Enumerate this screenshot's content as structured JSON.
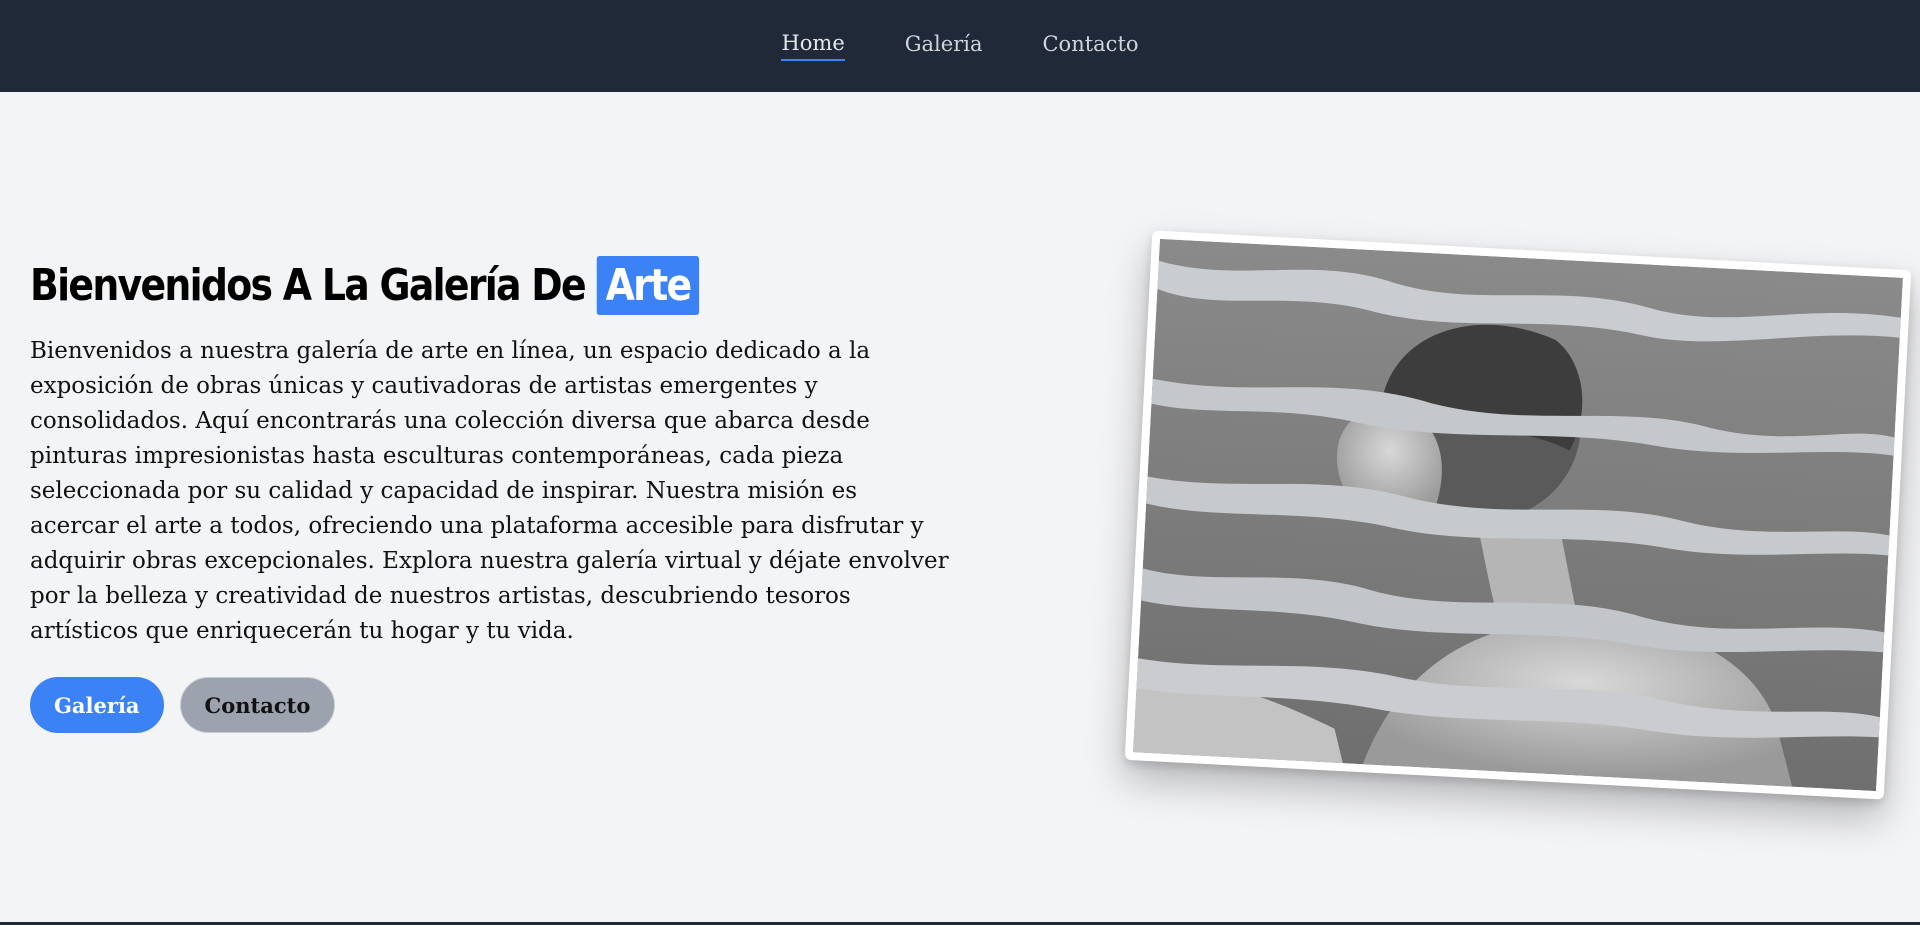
{
  "nav": {
    "items": [
      {
        "label": "Home",
        "active": true
      },
      {
        "label": "Galería",
        "active": false
      },
      {
        "label": "Contacto",
        "active": false
      }
    ]
  },
  "hero": {
    "title_main": "Bienvenidos A La Galería De",
    "title_highlight": "Arte",
    "description": "Bienvenidos a nuestra galería de arte en línea, un espacio dedicado a la exposición de obras únicas y cautivadoras de artistas emergentes y consolidados. Aquí encontrarás una colección diversa que abarca desde pinturas impresionistas hasta esculturas contemporáneas, cada pieza seleccionada por su calidad y capacidad de inspirar. Nuestra misión es acercar el arte a todos, ofreciendo una plataforma accesible para disfrutar y adquirir obras excepcionales. Explora nuestra galería virtual y déjate envolver por la belleza y creatividad de nuestros artistas, descubriendo tesoros artísticos que enriquecerán tu hogar y tu vida.",
    "primary_button": "Galería",
    "secondary_button": "Contacto"
  },
  "colors": {
    "navbar": "#1f2937",
    "accent": "#3b82f6",
    "background": "#f3f4f6",
    "secondary_button": "#9ca3af"
  },
  "image": {
    "subject": "torn-paper collage of classical statue"
  }
}
